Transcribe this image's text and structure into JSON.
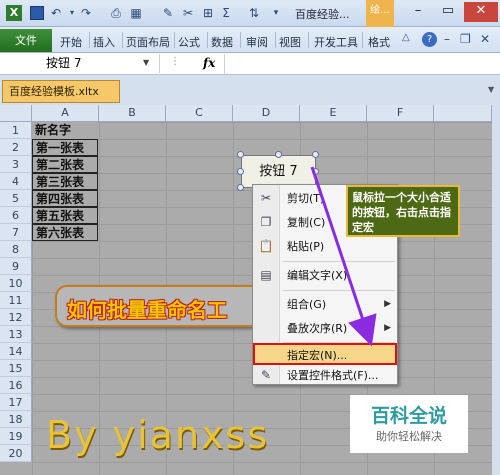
{
  "window": {
    "title": "百度经验...",
    "context_tab": "绘...",
    "minimize": "–",
    "maximize": "▭",
    "close": "✕"
  },
  "ribbon": {
    "file_tab": "文件",
    "tabs": [
      "开始",
      "插入",
      "页面布局",
      "公式",
      "数据",
      "审阅",
      "视图",
      "开发工具",
      "格式"
    ]
  },
  "formula_bar": {
    "name_box": "按钮 7",
    "fx": "fx"
  },
  "document_tab": "百度经验模板.xltx",
  "sheet": {
    "columns": [
      "A",
      "B",
      "C",
      "D",
      "E",
      "F"
    ],
    "rows": [
      "1",
      "2",
      "3",
      "4",
      "5",
      "6",
      "7",
      "8",
      "9",
      "10",
      "11",
      "12",
      "13",
      "14",
      "15",
      "16",
      "17",
      "18",
      "19",
      "20"
    ],
    "cells": [
      "新名字",
      "第一张表",
      "第二张表",
      "第三张表",
      "第四张表",
      "第五张表",
      "第六张表"
    ]
  },
  "button_control": "按钮 7",
  "annotation": "鼠标拉一个大小合适的按钮，右击点击指定宏",
  "context_menu": [
    {
      "label": "剪切(T)",
      "icon": "scissors-icon"
    },
    {
      "label": "复制(C)",
      "icon": "copy-icon"
    },
    {
      "label": "粘贴(P)",
      "icon": "paste-icon"
    },
    {
      "label": "编辑文字(X)",
      "icon": "edit-text-icon"
    },
    {
      "label": "组合(G)",
      "icon": "",
      "submenu": true
    },
    {
      "label": "叠放次序(R)",
      "icon": "",
      "submenu": true
    },
    {
      "label": "指定宏(N)...",
      "icon": "",
      "highlighted": true
    },
    {
      "label": "设置控件格式(F)...",
      "icon": "format-control-icon"
    }
  ],
  "overlay": {
    "banner": "如何批量重命名工",
    "byline": "By  yianxss",
    "logo_main": "百科全说",
    "logo_sub": "助你轻松解决"
  },
  "colors": {
    "excel_green": "#21701f",
    "tip_bg": "#4d6914",
    "tip_border": "#e8b93a",
    "highlight_border": "#dd1111",
    "arrow": "#8a2be2"
  }
}
